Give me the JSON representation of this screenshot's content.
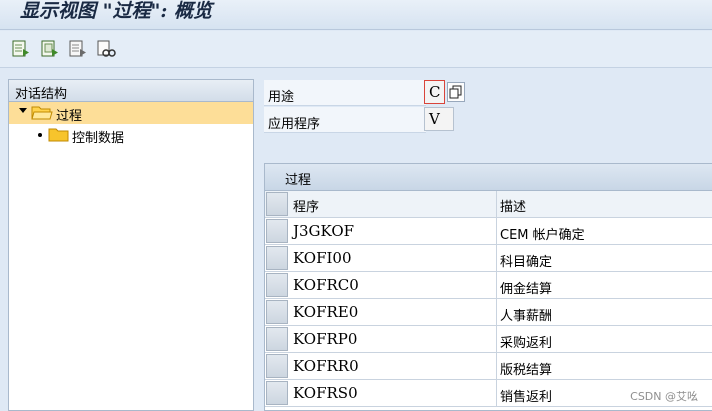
{
  "window": {
    "title": "显示视图 \"过程\": 概览"
  },
  "toolbar": {
    "buttons": [
      {
        "icon": "new-entries-icon"
      },
      {
        "icon": "copy-icon"
      },
      {
        "icon": "delete-icon"
      },
      {
        "icon": "select-all-icon"
      }
    ]
  },
  "tree": {
    "header": "对话结构",
    "items": [
      {
        "label": "过程",
        "selected": true,
        "expanded": true
      },
      {
        "label": "控制数据",
        "selected": false
      }
    ]
  },
  "fields": {
    "usage": {
      "label": "用途",
      "value": "C"
    },
    "application": {
      "label": "应用程序",
      "value": "V"
    }
  },
  "table": {
    "title": "过程",
    "columns": [
      "程序",
      "描述"
    ],
    "rows": [
      {
        "program": "J3GKOF",
        "description": "CEM 帐户确定"
      },
      {
        "program": "KOFI00",
        "description": "科目确定"
      },
      {
        "program": "KOFRC0",
        "description": "佣金结算"
      },
      {
        "program": "KOFRE0",
        "description": "人事薪酬"
      },
      {
        "program": "KOFRP0",
        "description": "采购返利"
      },
      {
        "program": "KOFRR0",
        "description": "版税结算"
      },
      {
        "program": "KOFRS0",
        "description": "销售返利"
      }
    ]
  },
  "watermark": "CSDN @艾吆",
  "colors": {
    "selection": "#fdde98",
    "background": "#dfe9f5",
    "focus": "#d9443a"
  }
}
